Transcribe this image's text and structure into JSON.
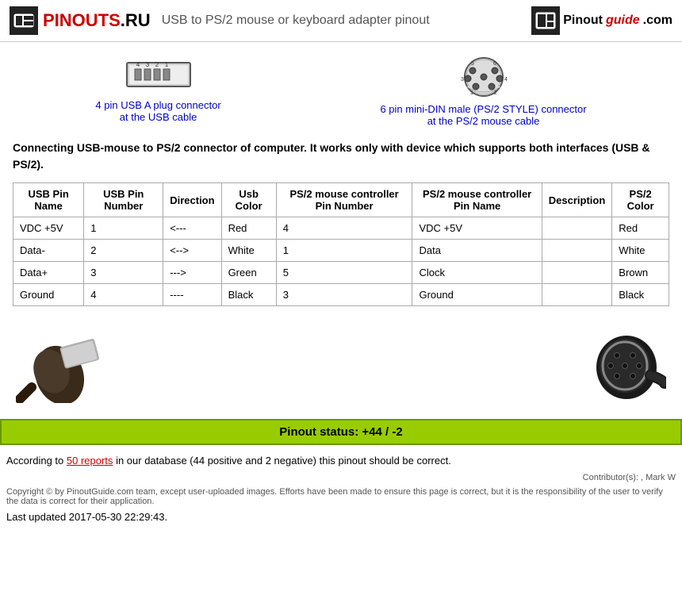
{
  "header": {
    "site_name": "PINOUTS.RU",
    "title": "USB to PS/2 mouse or keyboard adapter pinout",
    "logo_right": "Pinoutguide.com"
  },
  "connectors": [
    {
      "id": "usb",
      "link_text": "4 pin USB A plug connector",
      "link_text2": "at the USB cable"
    },
    {
      "id": "ps2",
      "link_text": "6 pin mini-DIN male (PS/2 STYLE) connector",
      "link_text2": "at the PS/2 mouse cable"
    }
  ],
  "description": "Connecting USB-mouse to PS/2 connector of computer. It works only with device which supports both interfaces (USB & PS/2).",
  "table": {
    "headers": [
      "USB Pin Name",
      "USB Pin Number",
      "Direction",
      "Usb Color",
      "PS/2 mouse controller Pin Number",
      "PS/2 mouse controller Pin Name",
      "Description",
      "PS/2 Color"
    ],
    "rows": [
      [
        "VDC +5V",
        "1",
        "<---",
        "Red",
        "4",
        "VDC +5V",
        "",
        "Red"
      ],
      [
        "Data-",
        "2",
        "<-->",
        "White",
        "1",
        "Data",
        "",
        "White"
      ],
      [
        "Data+",
        "3",
        "--->",
        "Green",
        "5",
        "Clock",
        "",
        "Brown"
      ],
      [
        "Ground",
        "4",
        "----",
        "Black",
        "3",
        "Ground",
        "",
        "Black"
      ]
    ]
  },
  "status": {
    "text": "Pinout status: +44 / -2",
    "reports_link": "50 reports",
    "according_text": "According to",
    "reports_detail": "in our database (44 positive and 2 negative) this pinout should be correct."
  },
  "footer": {
    "contributor": "Contributor(s):  , Mark W",
    "copyright": "Copyright © by PinoutGuide.com team, except user-uploaded images. Efforts have been made to ensure this page is correct, but it is the responsibility of the user to verify the data is correct for their application.",
    "last_updated": "Last updated 2017-05-30 22:29:43."
  }
}
